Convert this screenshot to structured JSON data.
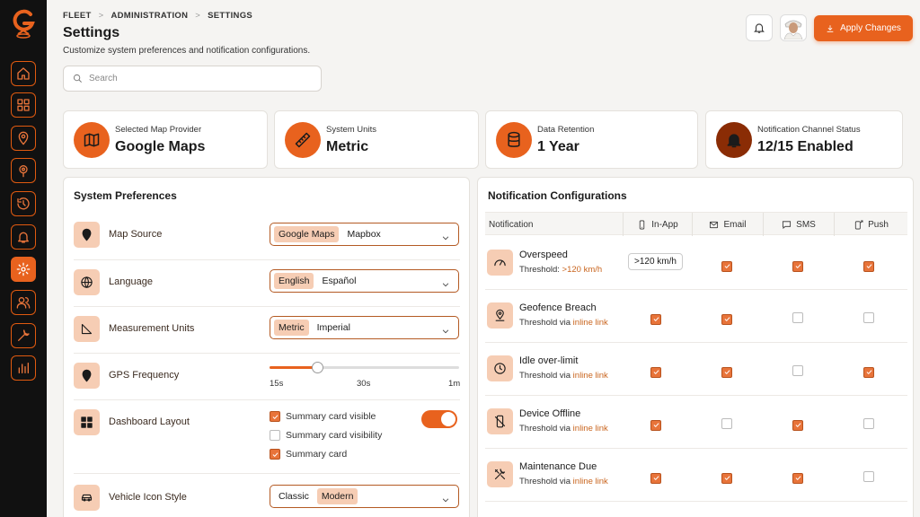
{
  "breadcrumb": [
    "FLEET",
    "ADMINISTRATION",
    "SETTINGS"
  ],
  "breadcrumb_sep": ">",
  "page": {
    "title": "Settings",
    "subtitle": "Customize system preferences and notification configurations."
  },
  "search": {
    "placeholder": "Search",
    "value": ""
  },
  "header": {
    "apply_label": "Apply Changes"
  },
  "colors": {
    "accent": "#e8621e",
    "accent_light": "#f6cdb4",
    "sidebar": "#111111"
  },
  "summary": [
    {
      "label": "Selected Map Provider",
      "value": "Google Maps",
      "icon": "map-icon"
    },
    {
      "label": "System Units",
      "value": "Metric",
      "icon": "ruler-icon"
    },
    {
      "label": "Data Retention",
      "value": "1 Year",
      "icon": "database-icon"
    },
    {
      "label": "Notification Channel Status",
      "value": "12/15 Enabled",
      "icon": "bell-icon"
    }
  ],
  "prefs": {
    "title": "System Preferences",
    "map_source": {
      "label": "Map Source",
      "options": [
        "Google Maps",
        "Mapbox"
      ],
      "selected": "Google Maps"
    },
    "language": {
      "label": "Language",
      "options": [
        "English",
        "Español"
      ],
      "selected": "English"
    },
    "units": {
      "label": "Measurement Units",
      "options": [
        "Metric",
        "Imperial"
      ],
      "selected": "Metric"
    },
    "gps": {
      "label": "GPS Frequency",
      "ticks": [
        "15s",
        "30s",
        "1m"
      ],
      "value_fraction": 0.25
    },
    "dashboard": {
      "label": "Dashboard Layout",
      "items": [
        {
          "label": "Summary card visible",
          "checked": true
        },
        {
          "label": "Summary card visibility",
          "checked": false
        },
        {
          "label": "Summary card",
          "checked": true
        }
      ],
      "toggle_on": true
    },
    "vehicle_icon": {
      "label": "Vehicle Icon Style",
      "options": [
        "Classic",
        "Modern"
      ],
      "selected": "Modern"
    }
  },
  "notifications": {
    "title": "Notification Configurations",
    "columns": [
      "Notification",
      "In-App",
      "Email",
      "SMS",
      "Push"
    ],
    "rows": [
      {
        "name": "Overspeed",
        "threshold_prefix": "Threshold:",
        "threshold_value": ">120 km/h",
        "in_app_value": ">120 km/h",
        "email": true,
        "sms": true,
        "push": true,
        "icon": "speedometer-icon"
      },
      {
        "name": "Geofence Breach",
        "threshold_prefix": "Threshold via",
        "threshold_value": "inline link",
        "in_app": true,
        "email": true,
        "sms": false,
        "push": false,
        "icon": "location-pin-icon"
      },
      {
        "name": "Idle over-limit",
        "threshold_prefix": "Threshold via",
        "threshold_value": "inline link",
        "in_app": true,
        "email": true,
        "sms": false,
        "push": true,
        "icon": "clock-icon"
      },
      {
        "name": "Device Offline",
        "threshold_prefix": "Threshold via",
        "threshold_value": "inline link",
        "in_app": true,
        "email": false,
        "sms": true,
        "push": false,
        "icon": "device-offline-icon"
      },
      {
        "name": "Maintenance Due",
        "threshold_prefix": "Threshold via",
        "threshold_value": "inline link",
        "in_app": true,
        "email": true,
        "sms": true,
        "push": false,
        "icon": "tools-icon"
      }
    ]
  }
}
